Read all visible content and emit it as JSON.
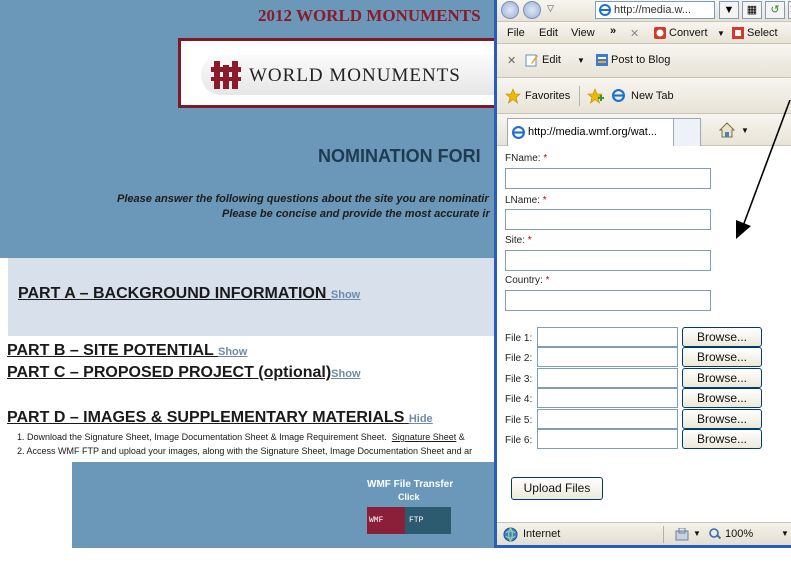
{
  "page": {
    "title_2012": "2012 WORLD MONUMENTS",
    "logo_text": "WORLD MONUMENTS",
    "nomination_title": "NOMINATION FORI",
    "instruction_1": "Please answer the following questions about the site you are nominatir",
    "instruction_2": "Please be concise and provide the most accurate ir",
    "part_a": {
      "label": "PART A – BACKGROUND INFORMATION",
      "toggle": "Show"
    },
    "part_b": {
      "label": "PART B – SITE POTENTIAL",
      "toggle": "Show"
    },
    "part_c": {
      "label": "PART C – PROPOSED PROJECT  (optional)",
      "toggle": "Show"
    },
    "part_d": {
      "label": "PART D – IMAGES & SUPPLEMENTARY MATERIALS",
      "toggle": "Hide"
    },
    "step_1": "1. Download the Signature Sheet, Image Documentation Sheet & Image Requirement Sheet.",
    "step_1_link": "Signature Sheet",
    "step_1_tail": " &",
    "step_2": "2. Access WMF FTP and upload your images, along with the Signature Sheet, Image Documentation Sheet and ar",
    "ftp_title": "WMF File Transfer",
    "ftp_click": "Click",
    "ftp_left": "WMF",
    "ftp_right": "FTP"
  },
  "browser": {
    "address": "http://media.w...",
    "menu": {
      "file": "File",
      "edit": "Edit",
      "view": "View",
      "more": "»",
      "convert": "Convert",
      "select": "Select"
    },
    "toolbar": {
      "edit": "Edit",
      "post_to_blog": "Post to Blog"
    },
    "favorites": {
      "label": "Favorites",
      "new_tab": "New Tab"
    },
    "tab": {
      "label": "http://media.wmf.org/wat..."
    },
    "form": {
      "fname_label": "FName:",
      "lname_label": "LName:",
      "site_label": "Site:",
      "country_label": "Country:",
      "required_mark": "*",
      "files": [
        {
          "label": "File 1:",
          "button": "Browse..."
        },
        {
          "label": "File 2:",
          "button": "Browse..."
        },
        {
          "label": "File 3:",
          "button": "Browse..."
        },
        {
          "label": "File 4:",
          "button": "Browse..."
        },
        {
          "label": "File 5:",
          "button": "Browse..."
        },
        {
          "label": "File 6:",
          "button": "Browse..."
        }
      ],
      "upload_button": "Upload Files"
    },
    "status": {
      "zone": "Internet",
      "zoom": "100%"
    }
  }
}
